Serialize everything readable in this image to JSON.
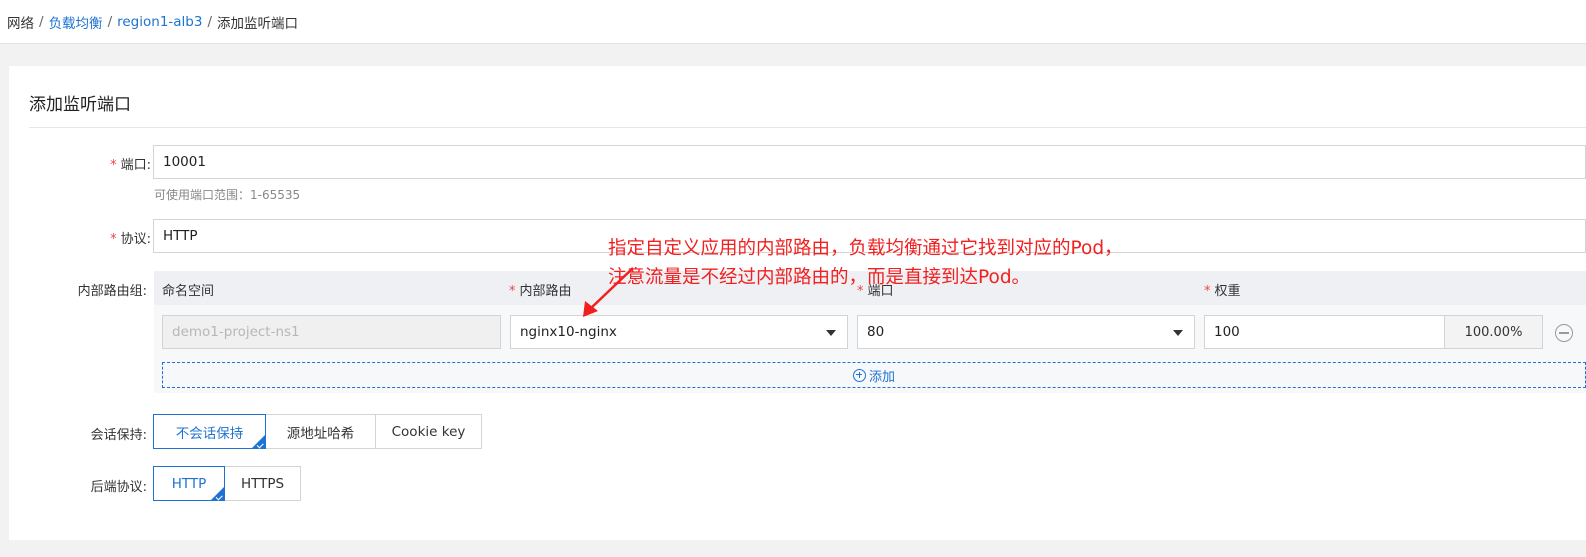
{
  "breadcrumb": {
    "items": [
      "网络",
      "负载均衡",
      "region1-alb3",
      "添加监听端口"
    ],
    "separator": "/"
  },
  "form": {
    "title": "添加监听端口",
    "port": {
      "label": "端口:",
      "value": "10001",
      "hint": "可使用端口范围：1-65535"
    },
    "protocol": {
      "label": "协议:",
      "value": "HTTP"
    },
    "route_group": {
      "label": "内部路由组:",
      "columns": [
        "命名空间",
        "内部路由",
        "端口",
        "权重"
      ],
      "row": {
        "namespace": "demo1-project-ns1",
        "route": "nginx10-nginx",
        "port": "80",
        "weight": "100",
        "weight_percent": "100.00%"
      },
      "add_label": "添加"
    },
    "session": {
      "label": "会话保持:",
      "options": [
        "不会话保持",
        "源地址哈希",
        "Cookie key"
      ],
      "selected": "不会话保持"
    },
    "backend": {
      "label": "后端协议:",
      "options": [
        "HTTP",
        "HTTPS"
      ],
      "selected": "HTTP"
    }
  },
  "annotation": {
    "line1": "指定自定义应用的内部路由，负载均衡通过它找到对应的Pod，",
    "line2": "注意流量是不经过内部路由的，而是直接到达Pod。"
  },
  "colors": {
    "accent": "#1e73d2",
    "required": "#e44444",
    "annotation": "#f21f1f"
  }
}
